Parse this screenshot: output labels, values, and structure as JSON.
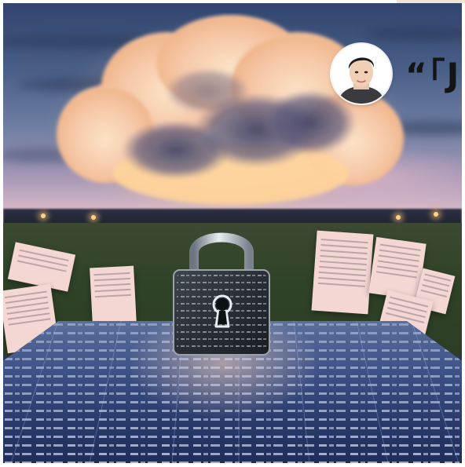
{
  "overlay": {
    "quote_text": "“「J",
    "avatar_name": "person-avatar"
  },
  "palette": {
    "sky_top": "#31456f",
    "sky_bottom": "#d7b8c7",
    "cloud_glow": "#ffcb8a",
    "field": "#2f4327",
    "table_blue": "#3d5286",
    "paper": "#f4d7d3",
    "lock_dark": "#2e3338"
  },
  "icons": {
    "lock": "padlock-icon",
    "cloud": "cloud-icon",
    "avatar": "avatar-icon"
  }
}
